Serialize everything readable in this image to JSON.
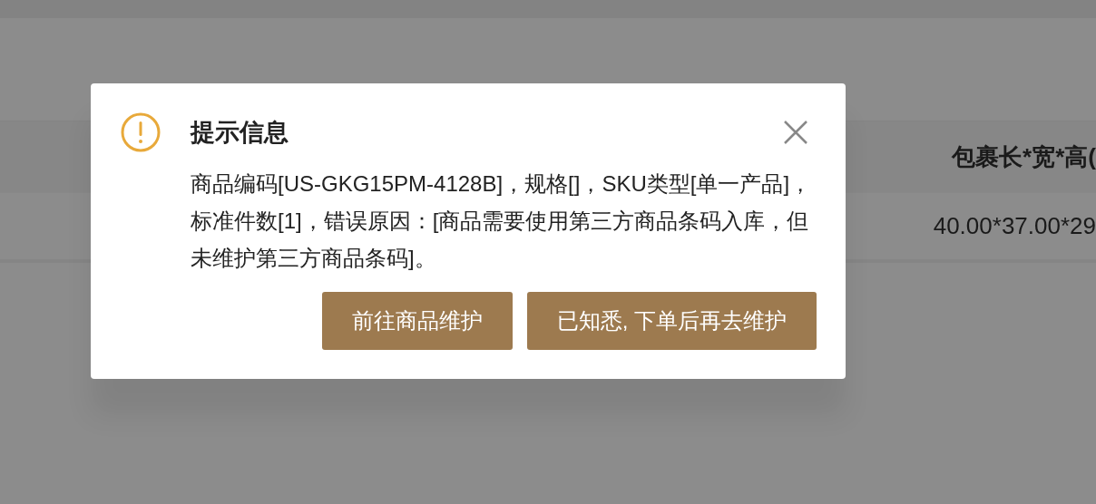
{
  "table": {
    "header": "包裹长*宽*高(",
    "rows": [
      "40.00*37.00*29"
    ]
  },
  "dialog": {
    "title": "提示信息",
    "message": "商品编码[US-GKG15PM-4128B]，规格[]，SKU类型[单一产品]，标准件数[1]，错误原因：[商品需要使用第三方商品条码入库，但未维护第三方商品条码]。",
    "buttons": [
      "前往商品维护",
      "已知悉, 下单后再去维护"
    ]
  }
}
